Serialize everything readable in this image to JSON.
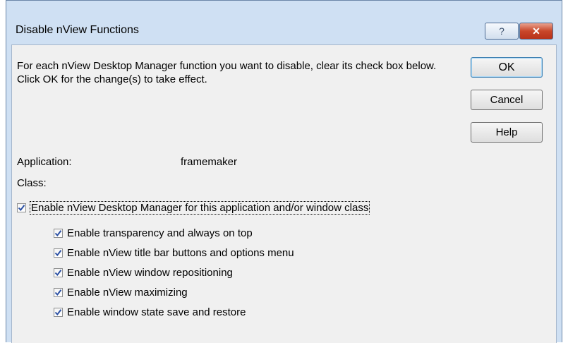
{
  "dialog": {
    "title": "Disable nView Functions",
    "description": "For each nView Desktop Manager function you want to disable, clear its check box below. Click OK for the change(s) to take effect.",
    "titlebar_help_glyph": "?",
    "titlebar_close_glyph": "✕"
  },
  "buttons": {
    "ok": "OK",
    "cancel": "Cancel",
    "help": "Help"
  },
  "fields": {
    "application_label": "Application:",
    "application_value": "framemaker",
    "class_label": "Class:"
  },
  "checkboxes": {
    "main": {
      "label": "Enable nView Desktop Manager for this application and/or window class",
      "checked": true
    },
    "items": [
      {
        "label": "Enable transparency and always on top",
        "checked": true
      },
      {
        "label": "Enable nView title bar buttons and options menu",
        "checked": true
      },
      {
        "label": "Enable nView window repositioning",
        "checked": true
      },
      {
        "label": "Enable nView maximizing",
        "checked": true
      },
      {
        "label": "Enable window state save and restore",
        "checked": true
      }
    ]
  },
  "colors": {
    "frame": "#cfe0f3",
    "client": "#f0f0f0",
    "close_button": "#c9472a",
    "check": "#2a4fa3"
  },
  "icons": [
    "help-icon",
    "close-icon",
    "check-icon"
  ]
}
